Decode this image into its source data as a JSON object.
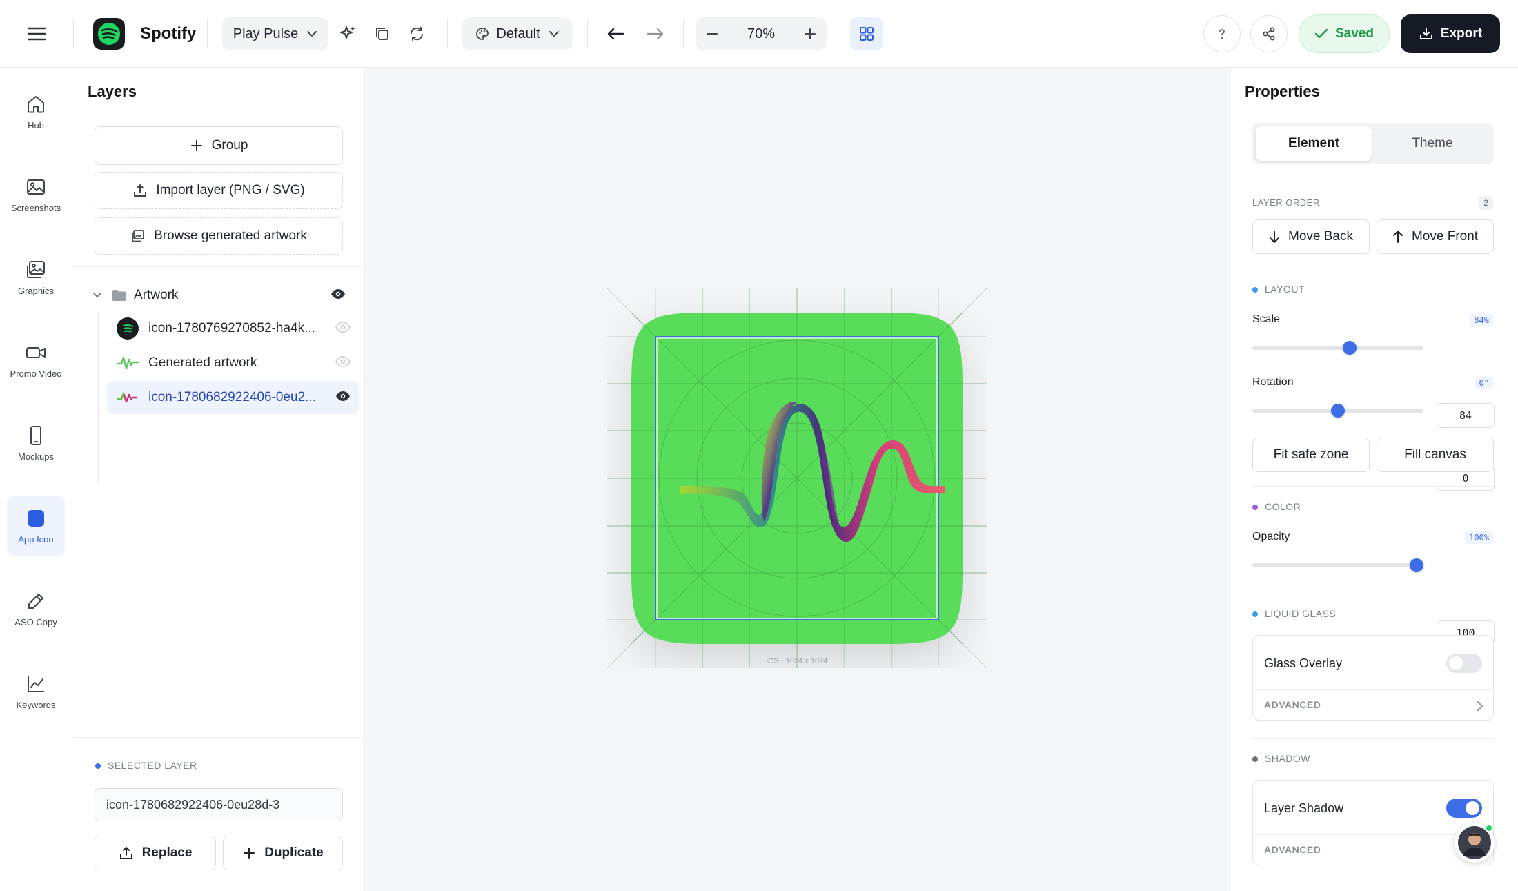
{
  "app": {
    "brand": "Spotify",
    "project": "Play Pulse",
    "theme_select": "Default",
    "zoom": "70%",
    "saved_label": "Saved",
    "export_label": "Export"
  },
  "nav": {
    "items": [
      {
        "label": "Hub",
        "icon": "home-icon"
      },
      {
        "label": "Screenshots",
        "icon": "image-icon"
      },
      {
        "label": "Graphics",
        "icon": "gallery-icon"
      },
      {
        "label": "Promo Video",
        "icon": "video-icon"
      },
      {
        "label": "Mockups",
        "icon": "phone-icon"
      },
      {
        "label": "App Icon",
        "icon": "app-icon-square"
      },
      {
        "label": "ASO Copy",
        "icon": "pencil-icon"
      },
      {
        "label": "Keywords",
        "icon": "chart-icon"
      }
    ],
    "active": "App Icon"
  },
  "layers": {
    "title": "Layers",
    "group_button": "Group",
    "import_button": "Import layer (PNG / SVG)",
    "browse_button": "Browse generated artwork",
    "group_name": "Artwork",
    "items": [
      {
        "name": "icon-1780769270852-ha4k..."
      },
      {
        "name": "Generated artwork"
      },
      {
        "name": "icon-1780682922406-0eu2..."
      }
    ],
    "selected_label": "SELECTED LAYER",
    "selected_value": "icon-1780682922406-0eu28d-3",
    "replace_button": "Replace",
    "duplicate_button": "Duplicate"
  },
  "canvas": {
    "caption": "iOS · 1024 x 1024",
    "icon_color": "#58dc5a"
  },
  "properties": {
    "title": "Properties",
    "tab_element": "Element",
    "tab_theme": "Theme",
    "layer_order_label": "LAYER ORDER",
    "layer_order_count": "2",
    "move_back": "Move Back",
    "move_front": "Move Front",
    "layout_label": "LAYOUT",
    "scale_label": "Scale",
    "scale_badge": "84%",
    "scale_value": "84",
    "scale_fraction": 0.57,
    "rotation_label": "Rotation",
    "rotation_badge": "0°",
    "rotation_value": "0",
    "rotation_fraction": 0.5,
    "fit_safe_zone": "Fit safe zone",
    "fill_canvas": "Fill canvas",
    "color_label": "COLOR",
    "opacity_label": "Opacity",
    "opacity_badge": "100%",
    "opacity_value": "100",
    "opacity_fraction": 0.96,
    "liquid_glass_label": "LIQUID GLASS",
    "glass_overlay": "Glass Overlay",
    "glass_overlay_on": false,
    "advanced_1": "ADVANCED",
    "shadow_label": "SHADOW",
    "layer_shadow": "Layer Shadow",
    "layer_shadow_on": true,
    "advanced_2": "ADVANCED"
  },
  "colors": {
    "accent": "#3d6ee8",
    "saved_bg": "#e8f8ec",
    "saved_text": "#1e9a44",
    "export_bg": "#161a24",
    "layout_dot": "#3d9be8",
    "color_dot": "#9b5de5",
    "liquid_dot": "#3d9be8",
    "shadow_dot": "#6b6f78"
  }
}
